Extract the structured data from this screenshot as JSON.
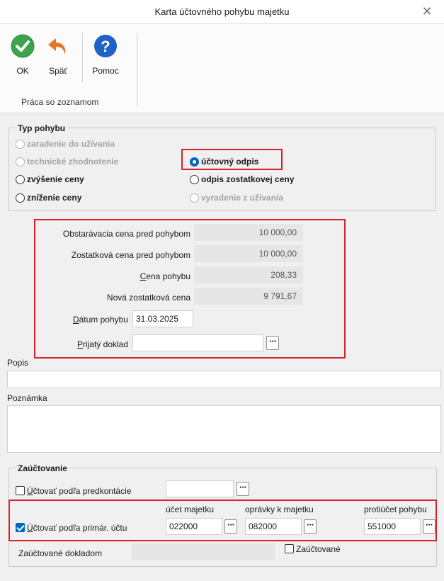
{
  "window": {
    "title": "Karta účtovného pohybu majetku"
  },
  "ribbon": {
    "ok_label": "OK",
    "back_label": "Späť",
    "help_label": "Pomoc",
    "group_label": "Práca so zoznamom",
    "colors": {
      "ok": "#3ea34a",
      "back": "#e8742c",
      "help": "#1f63c6"
    }
  },
  "typ_pohybu": {
    "legend": "Typ pohybu",
    "options": [
      {
        "label": "zaradenie do užívania",
        "enabled": false,
        "selected": false
      },
      {
        "label": "technické zhodnotenie",
        "enabled": false,
        "selected": false
      },
      {
        "label": "účtovný odpis",
        "enabled": true,
        "selected": true
      },
      {
        "label": "zvýšenie ceny",
        "enabled": true,
        "selected": false
      },
      {
        "label": "odpis zostatkovej ceny",
        "enabled": true,
        "selected": false
      },
      {
        "label": "zníženie ceny",
        "enabled": true,
        "selected": false
      },
      {
        "label": "vyradenie z užívania",
        "enabled": false,
        "selected": false
      }
    ]
  },
  "values": {
    "obstaravacia_label": "Obstarávacia cena pred pohybom",
    "obstaravacia_value": "10 000,00",
    "zostatkova_label": "Zostatková cena pred pohybom",
    "zostatkova_value": "10 000,00",
    "cena_label_u": "C",
    "cena_label_rest": "ena pohybu",
    "cena_value": "208,33",
    "nova_label": "Nová zostatková cena",
    "nova_value": "9 791,67",
    "datum_label_u": "D",
    "datum_label_rest": "átum pohybu",
    "datum_value": "31.03.2025",
    "doklad_label_u": "P",
    "doklad_label_rest": "rijatý doklad",
    "doklad_value": ""
  },
  "popis": {
    "label": "Popis",
    "value": ""
  },
  "poznamka": {
    "label": "Poznámka",
    "value": ""
  },
  "zauctovanie": {
    "legend": "Zaúčtovanie",
    "predkontacie_label_u": "Ú",
    "predkontacie_label_rest": "čtovať podľa predkontácie",
    "predkontacie_checked": false,
    "predkontacie_value": "",
    "primar_label_u": "Ú",
    "primar_label_rest": "čtovať podľa primár. účtu",
    "primar_checked": true,
    "ucet_majetku_label": "účet majetku",
    "ucet_majetku_value": "022000",
    "opravky_label": "oprávky k majetku",
    "opravky_value": "082000",
    "protiucet_label": "protiúčet pohybu",
    "protiucet_value": "551000",
    "doklad_label": "Zaúčtované dokladom",
    "doklad_value": "",
    "zauctovane_label": "Zaúčtované",
    "zauctovane_checked": false
  },
  "highlight_color": "#d6222a"
}
